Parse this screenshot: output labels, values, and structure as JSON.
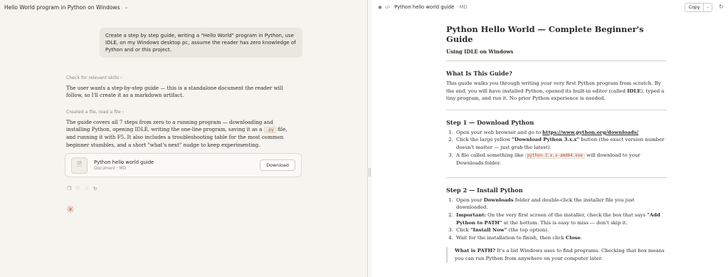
{
  "header": {
    "title": "Hello World program in Python on Windows"
  },
  "chat": {
    "user_message": "Create a step by step guide, writing a \"Hello World\" program in Python, use IDLE, on my Windows desktop pc, assume the reader has zero knowledge of Python and or this project.",
    "step1_link": "Check for relevant skills",
    "step1_text": "The user wants a step-by-step guide — this is a standalone document the reader will follow, so I'll create it as a markdown artifact.",
    "step2_link": "Created a file, read a file",
    "step2_text_a": "The guide covers all 7 steps from zero to a running program — downloading and installing Python, opening IDLE, writing the one-line program, saving it as a ",
    "step2_code": ".py",
    "step2_text_b": " file, and running it with F5. It also includes a troubleshooting table for the most common beginner stumbles, and a short \"what's next\" nudge to keep experimenting.",
    "artifact": {
      "title": "Python hello world guide",
      "subtitle": "Document · MD",
      "download_label": "Download"
    }
  },
  "panel": {
    "title": "Python hello world guide",
    "type": "MD",
    "copy_label": "Copy"
  },
  "doc": {
    "h1": "Python Hello World — Complete Beginner's Guide",
    "subtitle": "Using IDLE on Windows",
    "s0_heading": "What Is This Guide?",
    "s0_p_a": "This guide walks you through writing your very first Python program from scratch. By the end, you will have installed Python, opened its built-in editor (called ",
    "s0_p_b": "IDLE",
    "s0_p_c": "), typed a tiny program, and run it. No prior Python experience is needed.",
    "s1_heading": "Step 1 — Download Python",
    "s1_li1_a": "Open your web browser and go to ",
    "s1_li1_link": "https://www.python.org/downloads/",
    "s1_li2_a": "Click the large yellow ",
    "s1_li2_b": "\"Download Python 3.x.x\"",
    "s1_li2_c": " button (the exact version number doesn't matter — just grab the latest).",
    "s1_li3_a": "A file called something like ",
    "s1_li3_code": "python-3.x.x-amd64.exe",
    "s1_li3_b": " will download to your Downloads folder.",
    "s2_heading": "Step 2 — Install Python",
    "s2_li1_a": "Open your ",
    "s2_li1_b": "Downloads",
    "s2_li1_c": " folder and double-click the installer file you just downloaded.",
    "s2_li2_a": "Important:",
    "s2_li2_b": " On the very first screen of the installer, check the box that says ",
    "s2_li2_c": "\"Add Python to PATH\"",
    "s2_li2_d": " at the bottom. This is easy to miss — don't skip it.",
    "s2_li3_a": "Click ",
    "s2_li3_b": "\"Install Now\"",
    "s2_li3_c": " (the top option).",
    "s2_li4_a": "Wait for the installation to finish, then click ",
    "s2_li4_b": "Close",
    "s2_li4_c": ".",
    "note_a": "What is PATH?",
    "note_b": " It's a list Windows uses to find programs. Checking that box means you can run Python from anywhere on your computer later."
  }
}
